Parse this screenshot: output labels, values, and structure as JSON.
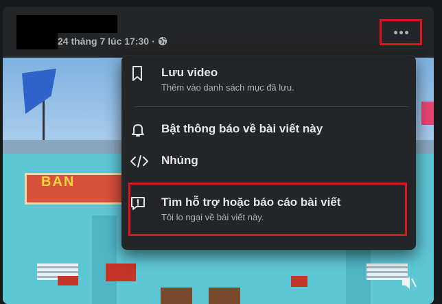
{
  "post": {
    "timestamp": "24 tháng 7 lúc 17:30",
    "separator": "·",
    "privacy_icon": "globe-icon",
    "more_icon": "more-horizontal-icon"
  },
  "photo": {
    "sign_text": "BAN"
  },
  "menu": {
    "items": [
      {
        "icon": "bookmark-icon",
        "label": "Lưu video",
        "sub": "Thêm vào danh sách mục đã lưu."
      },
      {
        "icon": "bell-icon",
        "label": "Bật thông báo về bài viết này",
        "sub": ""
      },
      {
        "icon": "code-icon",
        "label": "Nhúng",
        "sub": ""
      },
      {
        "icon": "report-icon",
        "label": "Tìm hỗ trợ hoặc báo cáo bài viết",
        "sub": "Tôi lo ngại về bài viết này."
      }
    ]
  },
  "colors": {
    "background": "#18191a",
    "card": "#242526",
    "primary_text": "#e4e6eb",
    "secondary_text": "#b0b3b8",
    "highlight_red": "#e0141e"
  }
}
